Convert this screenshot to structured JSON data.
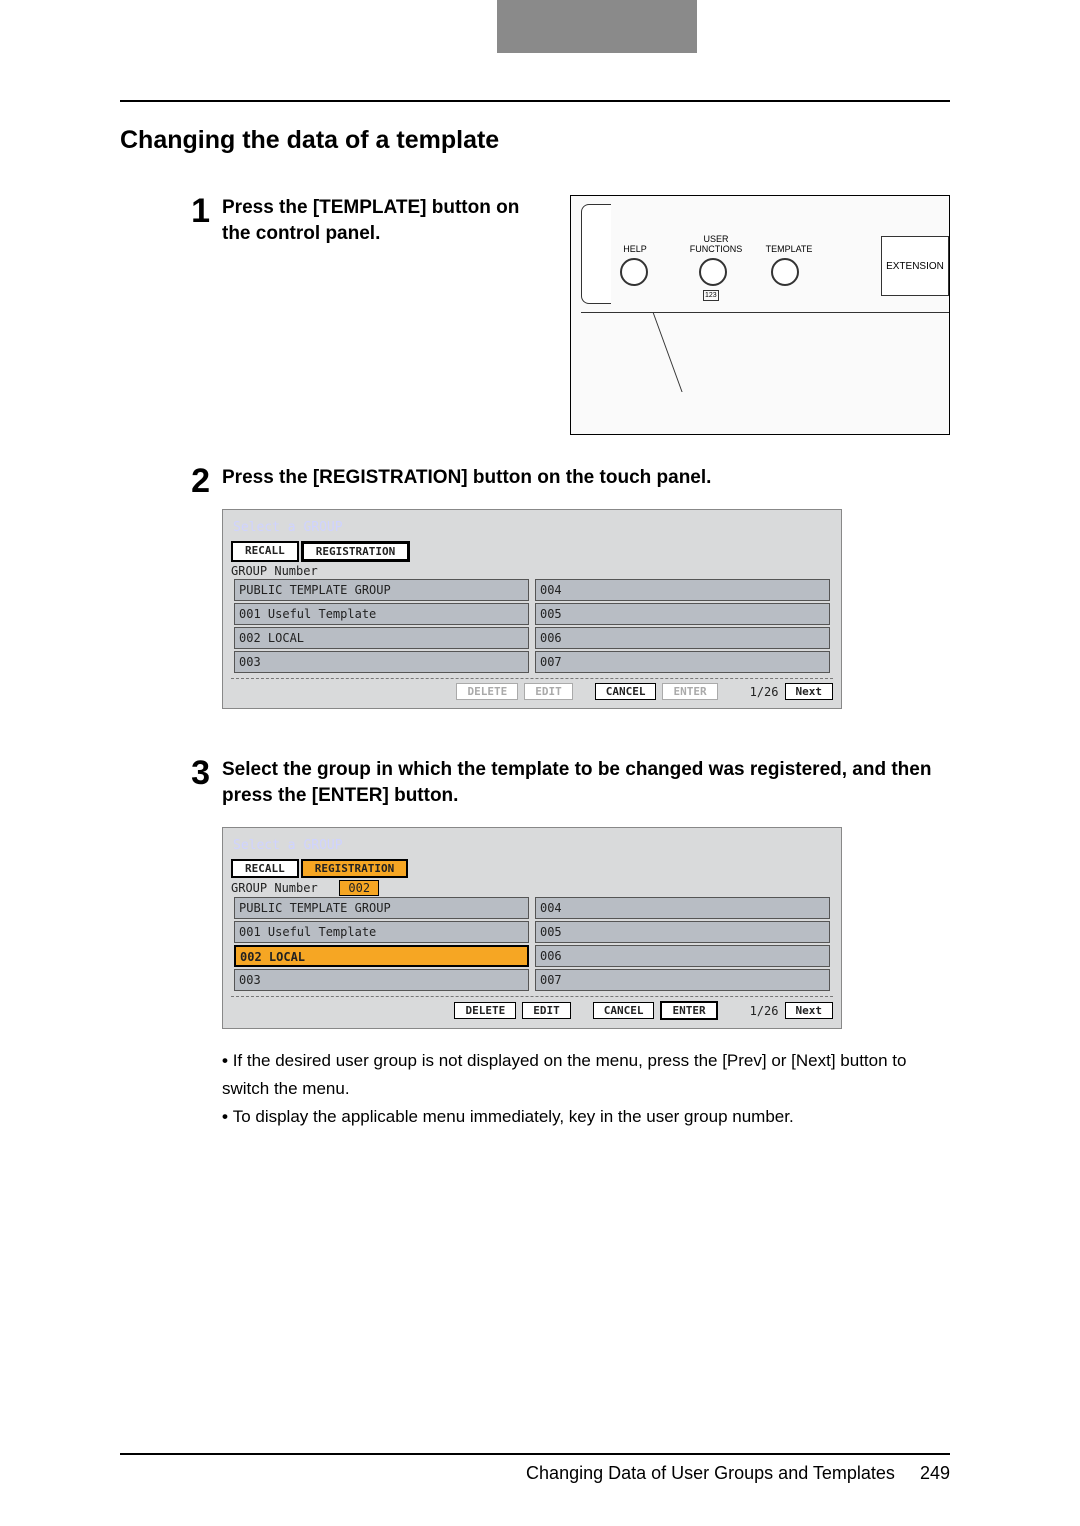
{
  "section_title": "Changing the data of a template",
  "steps": [
    {
      "num": "1",
      "text": "Press the [TEMPLATE] button on the control panel."
    },
    {
      "num": "2",
      "text": "Press the [REGISTRATION] button on the touch panel."
    },
    {
      "num": "3",
      "text": "Select the group in which the template to be changed was registered, and then press the [ENTER] button."
    }
  ],
  "panel": {
    "help": "HELP",
    "user_functions": "USER\nFUNCTIONS",
    "template": "TEMPLATE",
    "extension": "EXTENSION",
    "num123": "123"
  },
  "screen1": {
    "title": "Select a GROUP",
    "tab_recall": "RECALL",
    "tab_registration": "REGISTRATION",
    "group_num_label": "GROUP Number",
    "rows_left": [
      "    PUBLIC TEMPLATE GROUP",
      "001 Useful Template",
      "002 LOCAL",
      "003"
    ],
    "rows_right": [
      "004",
      "005",
      "006",
      "007"
    ],
    "delete": "DELETE",
    "edit": "EDIT",
    "cancel": "CANCEL",
    "enter": "ENTER",
    "pager": "1/26",
    "next": "Next"
  },
  "screen2": {
    "title": "Select a GROUP",
    "tab_recall": "RECALL",
    "tab_registration": "REGISTRATION",
    "group_num_label": "GROUP Number",
    "group_num_value": "002",
    "rows_left": [
      "    PUBLIC TEMPLATE GROUP",
      "001 Useful Template",
      "002 LOCAL",
      "003"
    ],
    "rows_right": [
      "004",
      "005",
      "006",
      "007"
    ],
    "delete": "DELETE",
    "edit": "EDIT",
    "cancel": "CANCEL",
    "enter": "ENTER",
    "pager": "1/26",
    "next": "Next"
  },
  "bullets": [
    "If the desired user group is not displayed on the menu, press the [Prev] or [Next] button to switch the menu.",
    "To display the applicable menu immediately, key in the user group number."
  ],
  "footer": {
    "text": "Changing Data of User Groups and Templates",
    "page": "249"
  }
}
